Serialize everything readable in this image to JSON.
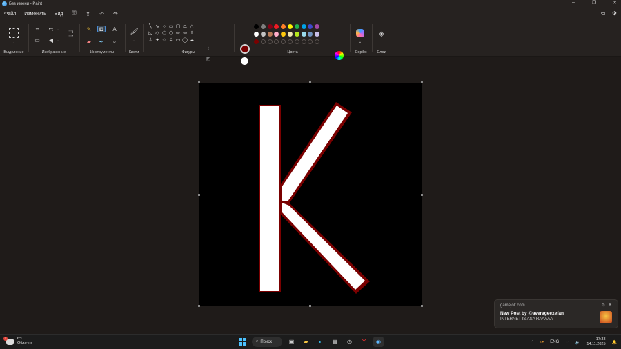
{
  "window": {
    "title": "Без имени - Paint",
    "controls": [
      "minimize-icon",
      "maximize-icon",
      "close-icon"
    ]
  },
  "menu": {
    "items": [
      "Файл",
      "Изменить",
      "Вид"
    ],
    "icons": [
      "save-icon",
      "open-icon",
      "undo-icon",
      "redo-icon"
    ],
    "right_icons": [
      "share-icon",
      "settings-icon"
    ]
  },
  "ribbon": {
    "groups": {
      "selection": "Выделение",
      "image": "Изображение",
      "tools": "Инструменты",
      "brushes": "Кисти",
      "shapes": "Фигуры",
      "colors": "Цвета",
      "copilot": "Copilot",
      "layers": "Слои"
    },
    "primary_color": "#7a0000",
    "secondary_color": "#ffffff",
    "palette": [
      "#000000",
      "#7f7f7f",
      "#880015",
      "#ed1c24",
      "#ff7f27",
      "#fff200",
      "#22b14c",
      "#00a2e8",
      "#3f48cc",
      "#a349a4",
      "#ffffff",
      "#c3c3c3",
      "#b97a57",
      "#ffaec9",
      "#ffc90e",
      "#efe4b0",
      "#b5e61d",
      "#99d9ea",
      "#7092be",
      "#c8bfe7",
      "#7a0000",
      "",
      "",
      "",
      "",
      "",
      "",
      "",
      "",
      ""
    ]
  },
  "canvas": {
    "background": "#000000",
    "letter_fill": "#ffffff",
    "letter_outline": "#7a0000"
  },
  "notification": {
    "source": "gamejolt.com",
    "title": "New Post by @averageexefan",
    "body": "INTERNET IS ASA RAAAAA-"
  },
  "taskbar": {
    "weather_temp": "6°C",
    "weather_desc": "Облачно",
    "weather_badge": "1",
    "search_label": "Поиск",
    "language": "ENG",
    "time": "17:33",
    "date": "14.11.2025"
  }
}
